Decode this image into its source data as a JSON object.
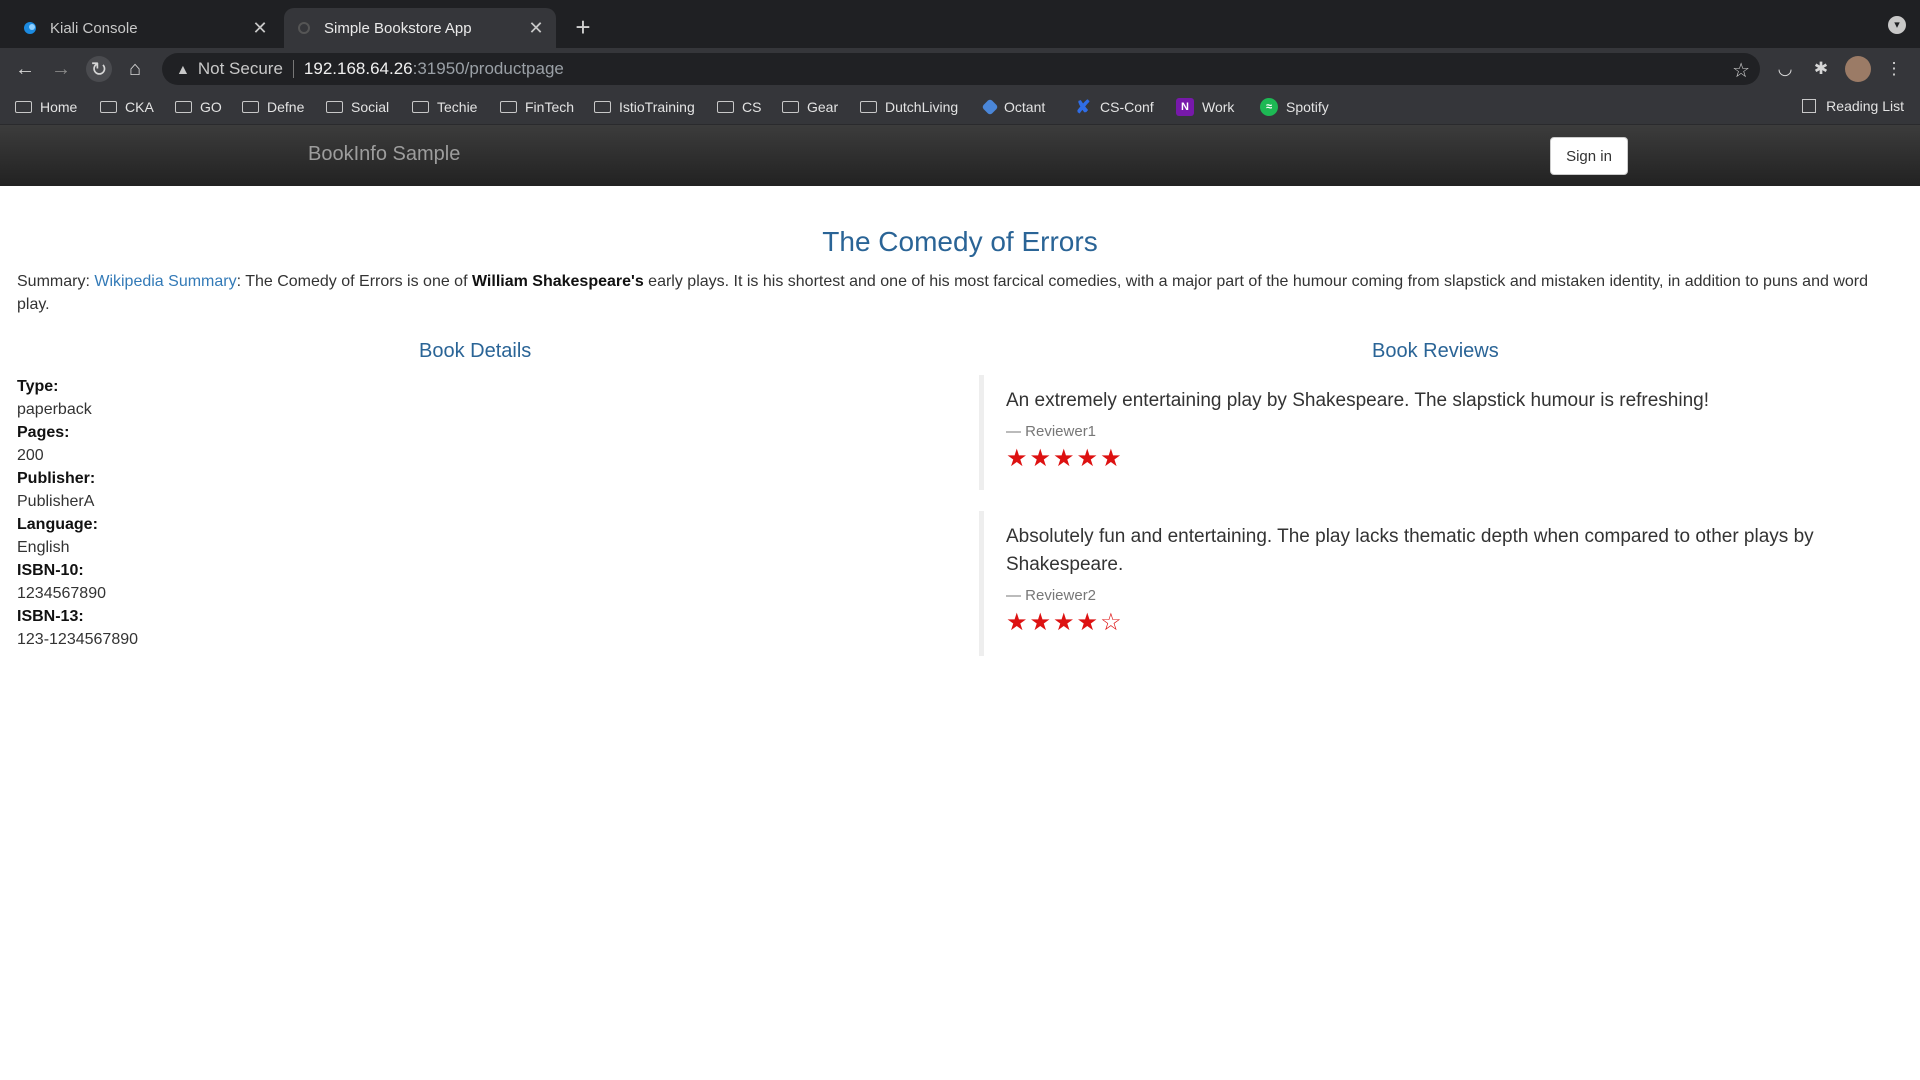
{
  "browser": {
    "tabs": [
      {
        "title": "Kiali Console",
        "active": false
      },
      {
        "title": "Simple Bookstore App",
        "active": true
      }
    ],
    "omnibox": {
      "security": "Not Secure",
      "host": "192.168.64.26",
      "path": ":31950/productpage"
    },
    "bookmarks": [
      "Home",
      "CKA",
      "GO",
      "Defne",
      "Social",
      "Techie",
      "FinTech",
      "IstioTraining",
      "CS",
      "Gear",
      "DutchLiving",
      "Octant",
      "CS-Conf",
      "Work",
      "Spotify"
    ],
    "reading_list": "Reading List"
  },
  "app": {
    "brand": "BookInfo Sample",
    "signin_label": "Sign in",
    "book_title": "The Comedy of Errors",
    "summary": {
      "prefix": "Summary: ",
      "link": "Wikipedia Summary",
      "text1": ": The Comedy of Errors is one of ",
      "bold": "William Shakespeare's",
      "text2": " early plays. It is his shortest and one of his most farcical comedies, with a major part of the humour coming from slapstick and mistaken identity, in addition to puns and word play."
    },
    "details_heading": "Book Details",
    "reviews_heading": "Book Reviews",
    "details": {
      "type_label": "Type:",
      "type": "paperback",
      "pages_label": "Pages:",
      "pages": "200",
      "publisher_label": "Publisher:",
      "publisher": "PublisherA",
      "language_label": "Language:",
      "language": "English",
      "isbn10_label": "ISBN-10:",
      "isbn10": "1234567890",
      "isbn13_label": "ISBN-13:",
      "isbn13": "123-1234567890"
    },
    "reviews": [
      {
        "text": "An extremely entertaining play by Shakespeare. The slapstick humour is refreshing!",
        "reviewer": "— Reviewer1",
        "stars": "★★★★★",
        "rating": 5
      },
      {
        "text": "Absolutely fun and entertaining. The play lacks thematic depth when compared to other plays by Shakespeare.",
        "reviewer": "— Reviewer2",
        "stars": "★★★★☆",
        "rating": 4
      }
    ],
    "colors": {
      "star": "#dd1111",
      "heading": "#2a6496",
      "link": "#337ab7"
    }
  }
}
